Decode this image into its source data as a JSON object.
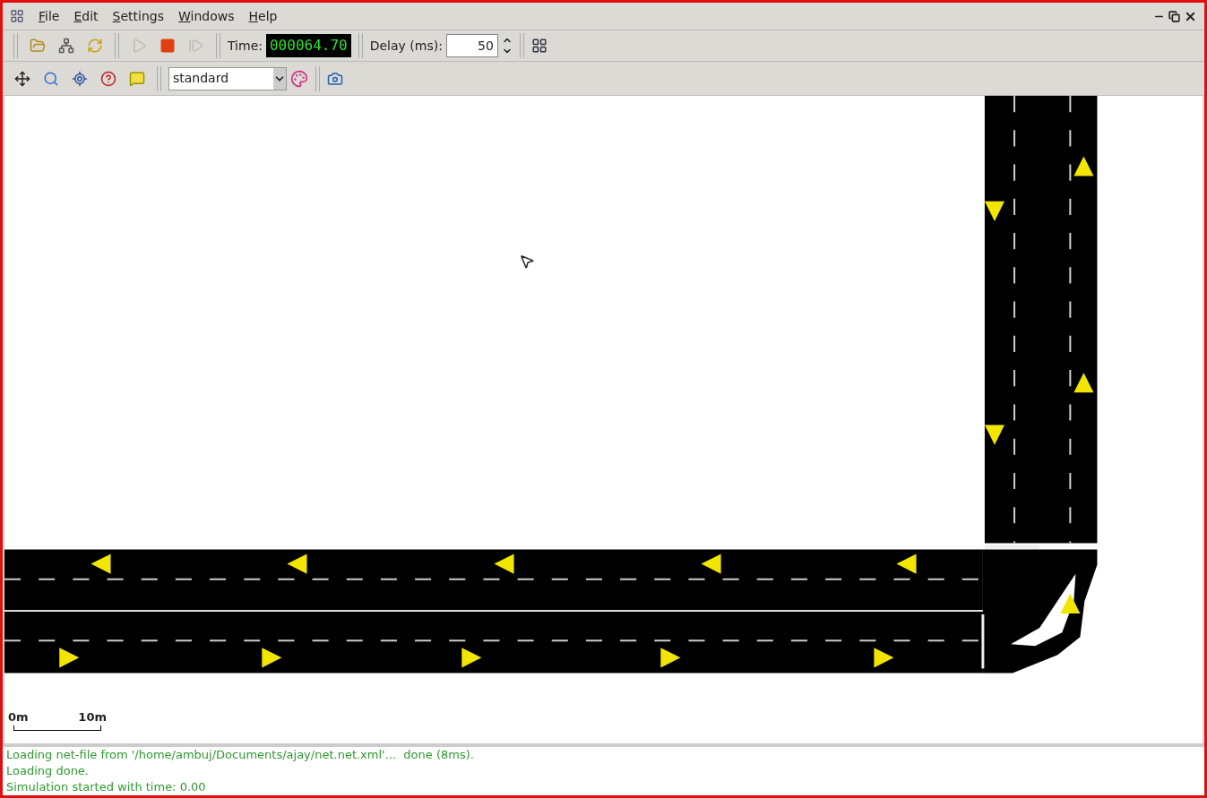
{
  "menu": [
    {
      "label": "File"
    },
    {
      "label": "Edit"
    },
    {
      "label": "Settings"
    },
    {
      "label": "Windows"
    },
    {
      "label": "Help"
    }
  ],
  "toolbar": {
    "controls": [
      {
        "kind": "open",
        "disabled": false
      },
      {
        "kind": "reload-net",
        "disabled": false
      },
      {
        "kind": "reload",
        "disabled": false
      },
      {
        "kind": "run",
        "disabled": true
      },
      {
        "kind": "stop",
        "disabled": false
      },
      {
        "kind": "step",
        "disabled": true
      }
    ],
    "time_label": "Time:",
    "time_value": "000064.70",
    "delay_label": "Delay (ms):",
    "delay_value": "50"
  },
  "view_toolbar": {
    "tools": [
      {
        "kind": "recenter"
      },
      {
        "kind": "zoom"
      },
      {
        "kind": "locate"
      },
      {
        "kind": "query"
      },
      {
        "kind": "tooltip"
      }
    ],
    "scheme": "standard"
  },
  "scale": {
    "start": "0m",
    "end": "10m"
  },
  "log": [
    "Loading net-file from '/home/ambuj/Documents/ajay/net.net.xml'...  done (8ms).",
    "Loading done.",
    "Simulation started with time: 0.00"
  ]
}
